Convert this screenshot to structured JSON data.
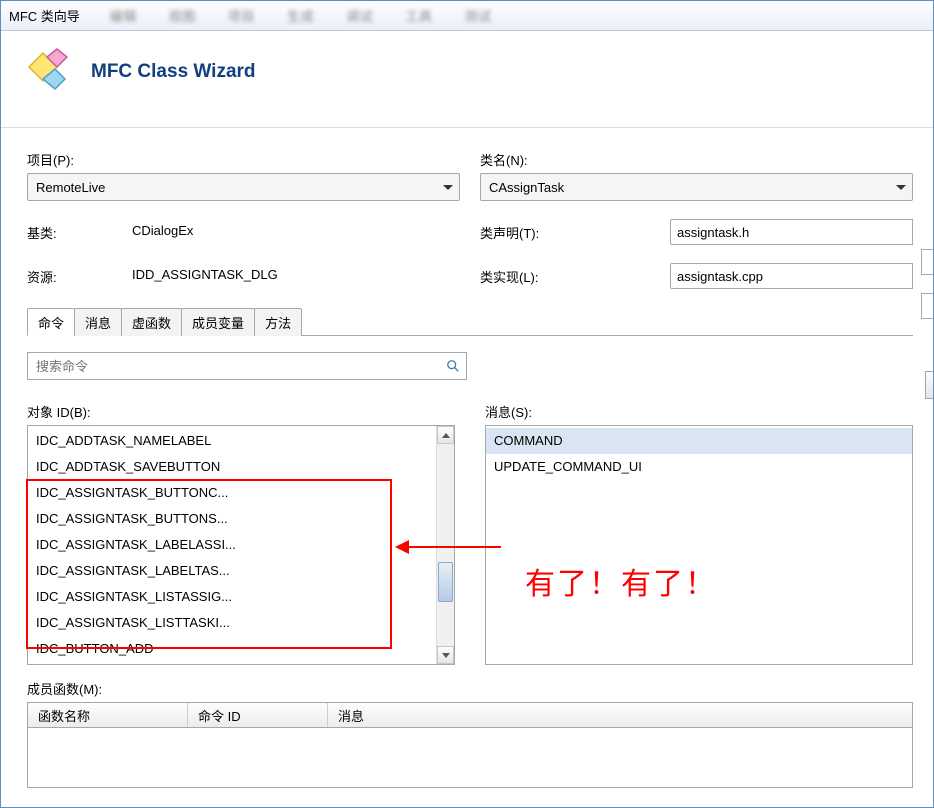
{
  "window": {
    "title": "MFC 类向导"
  },
  "header": {
    "title": "MFC Class Wizard"
  },
  "fields": {
    "project_label": "项目(P):",
    "project_value": "RemoteLive",
    "class_label": "类名(N):",
    "class_value": "CAssignTask",
    "base_label": "基类:",
    "base_value": "CDialogEx",
    "resource_label": "资源:",
    "resource_value": "IDD_ASSIGNTASK_DLG",
    "decl_label": "类声明(T):",
    "decl_value": "assigntask.h",
    "impl_label": "类实现(L):",
    "impl_value": "assigntask.cpp"
  },
  "tabs": [
    "命令",
    "消息",
    "虚函数",
    "成员变量",
    "方法"
  ],
  "search": {
    "placeholder": "搜索命令"
  },
  "object_ids": {
    "label": "对象 ID(B):",
    "items": [
      "IDC_ADDTASK_NAMELABEL",
      "IDC_ADDTASK_SAVEBUTTON",
      "IDC_ASSIGNTASK_BUTTONC...",
      "IDC_ASSIGNTASK_BUTTONS...",
      "IDC_ASSIGNTASK_LABELASSI...",
      "IDC_ASSIGNTASK_LABELTAS...",
      "IDC_ASSIGNTASK_LISTASSIG...",
      "IDC_ASSIGNTASK_LISTTASKI...",
      "IDC_BUTTON_ADD"
    ]
  },
  "messages": {
    "label": "消息(S):",
    "items": [
      "COMMAND",
      "UPDATE_COMMAND_UI"
    ]
  },
  "members": {
    "label": "成员函数(M):",
    "col_name": "函数名称",
    "col_cmdid": "命令 ID",
    "col_msg": "消息"
  },
  "annotation": "有了！有了！"
}
